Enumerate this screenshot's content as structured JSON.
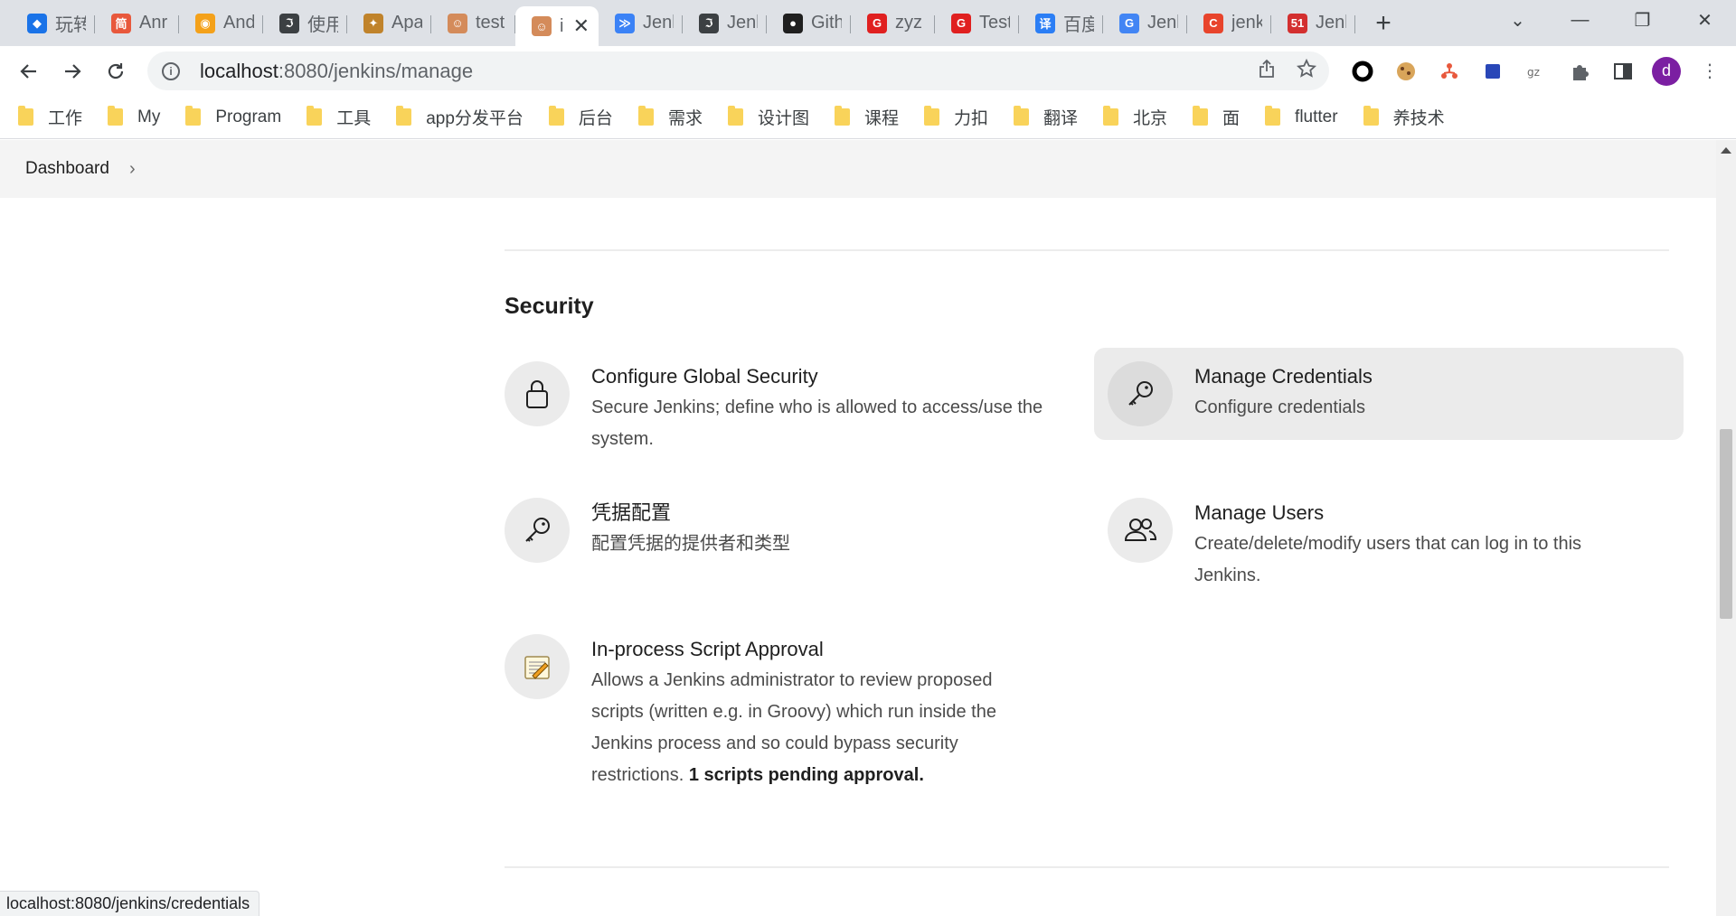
{
  "browser": {
    "tabs": [
      {
        "title": "玩转",
        "color": "#1a73e8",
        "glyph": "◆"
      },
      {
        "title": "Anr",
        "color": "#e8583c",
        "glyph": "简"
      },
      {
        "title": "And",
        "color": "#f4a11a",
        "glyph": "◉"
      },
      {
        "title": "使用",
        "color": "#3c4043",
        "glyph": "ℑ"
      },
      {
        "title": "Apa",
        "color": "#c0832b",
        "glyph": "✦"
      },
      {
        "title": "test",
        "color": "#d48b5a",
        "glyph": "☺"
      },
      {
        "title": "i",
        "color": "#d48b5a",
        "glyph": "☺",
        "active": true
      },
      {
        "title": "Jenk",
        "color": "#3b82f6",
        "glyph": "≫"
      },
      {
        "title": "Jenk",
        "color": "#3c4043",
        "glyph": "ℑ"
      },
      {
        "title": "Gith",
        "color": "#1f1f1f",
        "glyph": "●"
      },
      {
        "title": "zyz",
        "color": "#e02020",
        "glyph": "G"
      },
      {
        "title": "Test",
        "color": "#e02020",
        "glyph": "G"
      },
      {
        "title": "百度",
        "color": "#2b7ef5",
        "glyph": "译"
      },
      {
        "title": "Jenk",
        "color": "#4285f4",
        "glyph": "G"
      },
      {
        "title": "jenk",
        "color": "#e8442c",
        "glyph": "C"
      },
      {
        "title": "Jenk",
        "color": "#d32f2f",
        "glyph": "51"
      }
    ],
    "new_tab_label": "+",
    "url_host": "localhost",
    "url_rest": ":8080/jenkins/manage",
    "profile_initial": "d",
    "bookmarks": [
      "工作",
      "My",
      "Program",
      "工具",
      "app分发平台",
      "后台",
      "需求",
      "设计图",
      "课程",
      "力扣",
      "翻译",
      "北京",
      "面",
      "flutter",
      "养技术"
    ]
  },
  "breadcrumb": {
    "items": [
      "Dashboard"
    ]
  },
  "section": {
    "title": "Security",
    "items": [
      {
        "icon": "lock-icon",
        "title": "Configure Global Security",
        "desc": "Secure Jenkins; define who is allowed to access/use the system."
      },
      {
        "icon": "key-icon",
        "title": "Manage Credentials",
        "desc": "Configure credentials",
        "hovered": true
      },
      {
        "icon": "key-icon",
        "title": "凭据配置",
        "desc": "配置凭据的提供者和类型"
      },
      {
        "icon": "users-icon",
        "title": "Manage Users",
        "desc": "Create/delete/modify users that can log in to this Jenkins."
      },
      {
        "icon": "script-approval-icon",
        "title": "In-process Script Approval",
        "desc": "Allows a Jenkins administrator to review proposed scripts (written e.g. in Groovy) which run inside the Jenkins process and so could bypass security restrictions.",
        "desc_bold": "1 scripts pending approval."
      }
    ]
  },
  "status_bar": {
    "url": "localhost:8080/jenkins/credentials"
  }
}
